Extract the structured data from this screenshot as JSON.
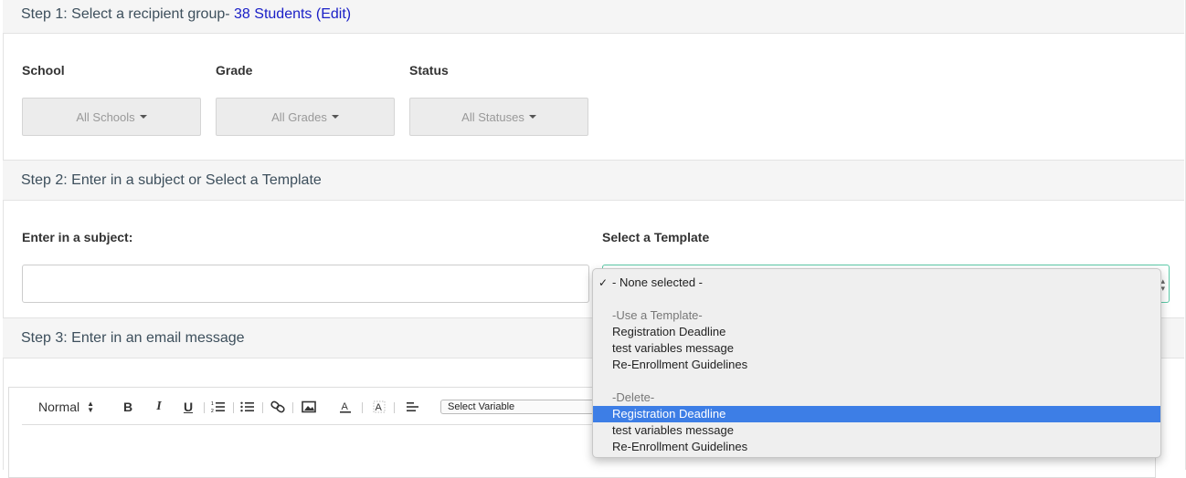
{
  "step1": {
    "prefix": "Step 1: Select a recipient group-",
    "count_link": "38 Students",
    "edit_link": "(Edit)"
  },
  "filters": [
    {
      "label": "School",
      "button": "All Schools"
    },
    {
      "label": "Grade",
      "button": "All Grades"
    },
    {
      "label": "Status",
      "button": "All Statuses"
    }
  ],
  "step2": {
    "title": "Step 2: Enter in a subject or Select a Template",
    "subject_label": "Enter in a subject:",
    "subject_value": "",
    "template_label": "Select a Template"
  },
  "step3": {
    "title": "Step 3: Enter in an email message"
  },
  "editor": {
    "format": "Normal",
    "bold": "B",
    "italic": "I",
    "underline": "U",
    "variable_select": "Select Variable"
  },
  "template_dropdown": {
    "selected": "- None selected -",
    "check": "✓",
    "group_use": "-Use a Template-",
    "use_items": [
      "Registration Deadline",
      "test variables message",
      "Re-Enrollment Guidelines"
    ],
    "group_delete": "-Delete-",
    "delete_items": [
      "Registration Deadline",
      "test variables message",
      "Re-Enrollment Guidelines"
    ],
    "highlighted": "Registration Deadline"
  },
  "colors": {
    "accent_link": "#1b20c7",
    "highlight": "#3d7ee6",
    "focus_border": "#5cc9a7"
  }
}
